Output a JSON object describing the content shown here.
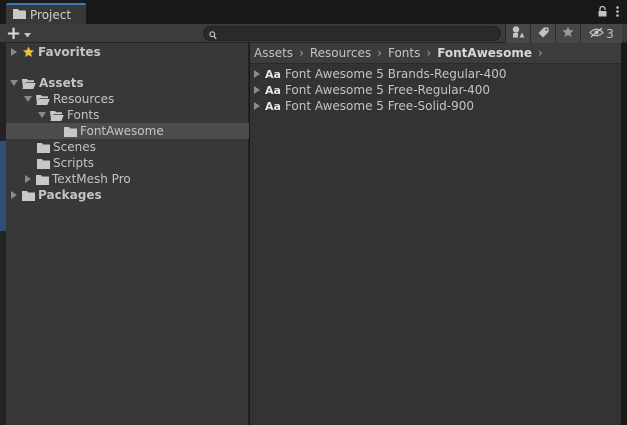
{
  "window": {
    "tab_title": "Project",
    "hidden_count": "3"
  },
  "toolbar": {
    "add_label": "+",
    "search_placeholder": "",
    "search_value": ""
  },
  "tree": [
    {
      "label": "Favorites",
      "bold": true,
      "icon": "star-icon"
    },
    {
      "label": "Assets",
      "bold": true,
      "icon": "folder-open-icon"
    },
    {
      "label": "Resources",
      "bold": false,
      "icon": "folder-open-icon"
    },
    {
      "label": "Fonts",
      "bold": false,
      "icon": "folder-open-icon"
    },
    {
      "label": "FontAwesome",
      "bold": false,
      "icon": "folder-icon",
      "selected": true
    },
    {
      "label": "Scenes",
      "bold": false,
      "icon": "folder-icon"
    },
    {
      "label": "Scripts",
      "bold": false,
      "icon": "folder-icon"
    },
    {
      "label": "TextMesh Pro",
      "bold": false,
      "icon": "folder-icon"
    },
    {
      "label": "Packages",
      "bold": true,
      "icon": "folder-icon"
    }
  ],
  "breadcrumb": [
    "Assets",
    "Resources",
    "Fonts",
    "FontAwesome"
  ],
  "assets": [
    {
      "icon_text": "Aa",
      "label": "Font Awesome 5 Brands-Regular-400"
    },
    {
      "icon_text": "Aa",
      "label": "Font Awesome 5 Free-Regular-400"
    },
    {
      "icon_text": "Aa",
      "label": "Font Awesome 5 Free-Solid-900"
    }
  ],
  "colors": {
    "accent": "#3a79bb",
    "star": "#f0c23a",
    "folder": "#c8c8c8",
    "panel": "#383838",
    "content": "#333333"
  }
}
